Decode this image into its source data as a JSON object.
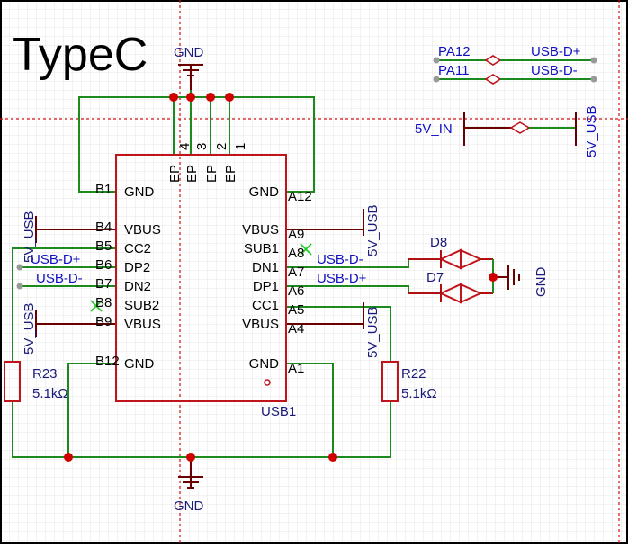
{
  "title": "TypeC",
  "colors": {
    "wire": "#1c8a1c",
    "component": "#c0141a",
    "junction": "#d00000",
    "net_label": "#1010c0",
    "designator": "#1a1a7a",
    "grid": "#e6e6e6",
    "crosshair": "#d01010"
  },
  "connector": {
    "designator": "USB1",
    "ep_pins": [
      {
        "name": "EP",
        "num": "4"
      },
      {
        "name": "EP",
        "num": "3"
      },
      {
        "name": "EP",
        "num": "2"
      },
      {
        "name": "EP",
        "num": "1"
      }
    ],
    "left_pins": [
      {
        "num": "B1",
        "name": "GND"
      },
      {
        "num": "B4",
        "name": "VBUS"
      },
      {
        "num": "B5",
        "name": "CC2"
      },
      {
        "num": "B6",
        "name": "DP2"
      },
      {
        "num": "B7",
        "name": "DN2"
      },
      {
        "num": "B8",
        "name": "SUB2"
      },
      {
        "num": "B9",
        "name": "VBUS"
      },
      {
        "num": "B12",
        "name": "GND"
      }
    ],
    "right_pins": [
      {
        "num": "A12",
        "name": "GND"
      },
      {
        "num": "A9",
        "name": "VBUS"
      },
      {
        "num": "A8",
        "name": "SUB1"
      },
      {
        "num": "A7",
        "name": "DN1"
      },
      {
        "num": "A6",
        "name": "DP1"
      },
      {
        "num": "A5",
        "name": "CC1"
      },
      {
        "num": "A4",
        "name": "VBUS"
      },
      {
        "num": "A1",
        "name": "GND"
      }
    ]
  },
  "nets": {
    "gnd_top": "GND",
    "gnd_bottom": "GND",
    "gnd_diode": "GND",
    "vbus_left_top": "5V_USB",
    "vbus_left_bottom": "5V_USB",
    "vbus_right_top": "5V_USB",
    "vbus_right_bottom": "5V_USB",
    "left_dp": "USB-D+",
    "left_dn": "USB-D-",
    "right_dn": "USB-D-",
    "right_dp": "USB-D+",
    "pa12": "PA12",
    "pa11": "PA11",
    "usb_dp_top": "USB-D+",
    "usb_dn_top": "USB-D-",
    "v5_in": "5V_IN",
    "v5_usb_top": "5V_USB"
  },
  "resistors": [
    {
      "designator": "R23",
      "value": "5.1kΩ"
    },
    {
      "designator": "R22",
      "value": "5.1kΩ"
    }
  ],
  "diodes": [
    {
      "designator": "D8"
    },
    {
      "designator": "D7"
    }
  ]
}
